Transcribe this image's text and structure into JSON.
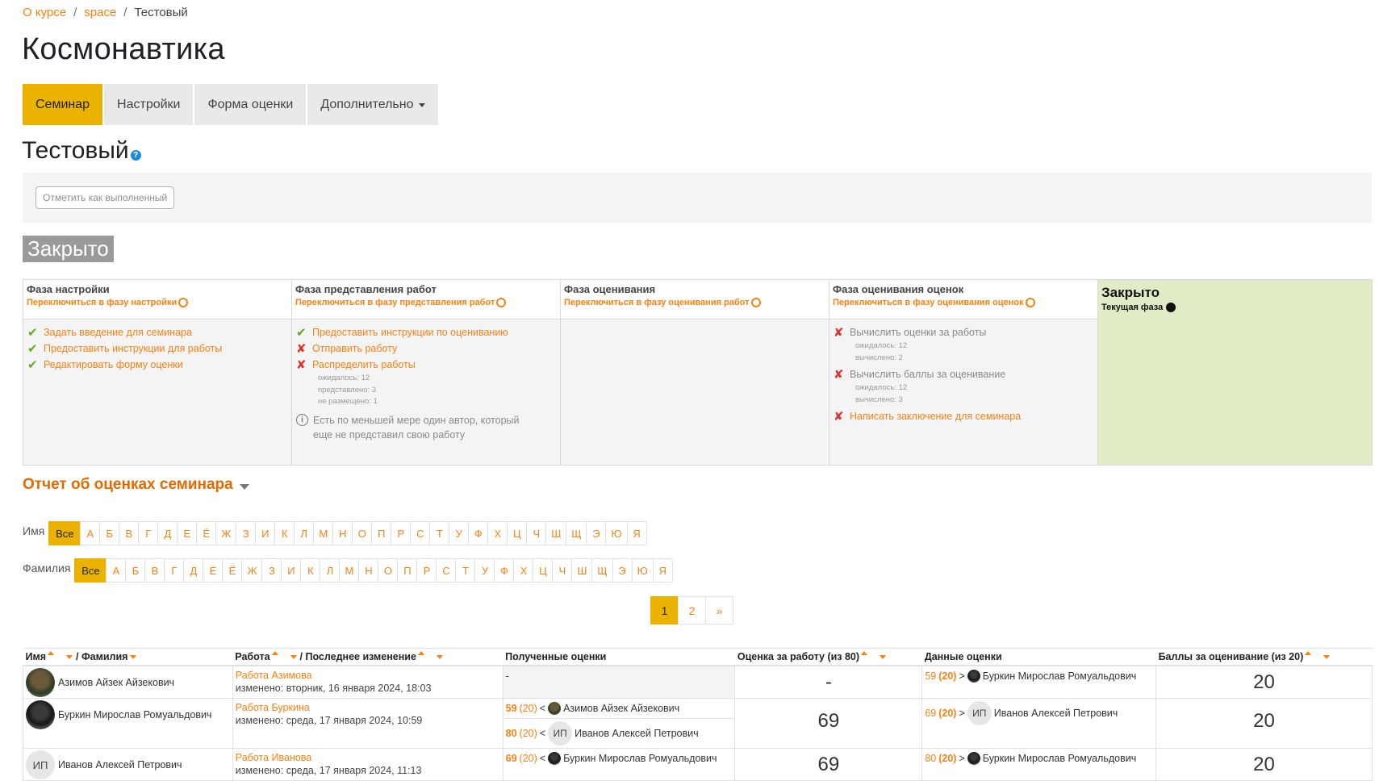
{
  "breadcrumb": {
    "items": [
      "О курсе",
      "space",
      "Тестовый"
    ],
    "separator": "/"
  },
  "title": "Космонавтика",
  "tabs": [
    {
      "label": "Семинар",
      "active": true
    },
    {
      "label": "Настройки",
      "active": false
    },
    {
      "label": "Форма оценки",
      "active": false
    },
    {
      "label": "Дополнительно",
      "active": false,
      "dropdown": true
    }
  ],
  "subtitle": "Тестовый",
  "help_icon": "question-icon",
  "done_button": "Отметить как выполненный",
  "closed_badge": "Закрыто",
  "phases": [
    {
      "name": "Фаза настройки",
      "switch": "Переключиться в фазу настройки",
      "tasks": [
        {
          "status": "done",
          "label": "Задать введение для семинара"
        },
        {
          "status": "done",
          "label": "Предоставить инструкции для работы"
        },
        {
          "status": "done",
          "label": "Редактировать форму оценки"
        }
      ]
    },
    {
      "name": "Фаза представления работ",
      "switch": "Переключиться в фазу представления работ",
      "tasks": [
        {
          "status": "done",
          "label": "Предоставить инструкции по оцениванию"
        },
        {
          "status": "fail",
          "label": "Отправить работу"
        },
        {
          "status": "fail",
          "label": "Распределить работы",
          "details": [
            "ожидалось: 12",
            "представлено: 3",
            "не размещено: 1"
          ]
        }
      ],
      "info": "Есть по меньшей мере один автор, который еще не представил свою работу"
    },
    {
      "name": "Фаза оценивания",
      "switch": "Переключиться в фазу оценивания работ",
      "tasks": []
    },
    {
      "name": "Фаза оценивания оценок",
      "switch": "Переключиться в фазу оценивания оценок",
      "tasks": [
        {
          "status": "fail",
          "grey": true,
          "label": "Вычислить оценки за работы",
          "details": [
            "ожидалось: 12",
            "вычислено: 2"
          ]
        },
        {
          "status": "fail",
          "grey": true,
          "label": "Вычислить баллы за оценивание",
          "details": [
            "ожидалось: 12",
            "вычислено: 3"
          ]
        },
        {
          "status": "fail",
          "grey": false,
          "label": "Написать заключение для семинара"
        }
      ]
    }
  ],
  "current_phase": {
    "name": "Закрыто",
    "label": "Текущая фаза"
  },
  "report": {
    "title": "Отчет об оценках семинара"
  },
  "filters": {
    "first_name_label": "Имя",
    "last_name_label": "Фамилия",
    "all_label": "Все",
    "letters": [
      "А",
      "Б",
      "В",
      "Г",
      "Д",
      "Е",
      "Ё",
      "Ж",
      "З",
      "И",
      "К",
      "Л",
      "М",
      "Н",
      "О",
      "П",
      "Р",
      "С",
      "Т",
      "У",
      "Ф",
      "Х",
      "Ц",
      "Ч",
      "Ш",
      "Щ",
      "Э",
      "Ю",
      "Я"
    ]
  },
  "pagination": {
    "pages": [
      "1",
      "2"
    ],
    "next": "»",
    "current": "1"
  },
  "table": {
    "headers": {
      "first_name": "Имя",
      "last_name": "/ Фамилия",
      "work": "Работа",
      "modified": "/ Последнее изменение",
      "received": "Полученные оценки",
      "work_grade": "Оценка за работу (из 80)",
      "given": "Данные оценки",
      "assess_grade": "Баллы за оценивание (из 20)"
    },
    "rows": [
      {
        "name": "Азимов Айзек Айзекович",
        "avatar": "photo1",
        "work_title": "Работа Азимова",
        "modified": "изменено: вторник, 16 января 2024, 18:03",
        "received": [
          {
            "text": "-"
          }
        ],
        "work_grade": "-",
        "given": [
          {
            "grade": "59",
            "weight": "(20)",
            "arrow": ">",
            "reviewer": "Буркин Мирослав Ромуальдович",
            "avatar": "photo2"
          }
        ],
        "assess_grade": "20"
      },
      {
        "name": "Буркин Мирослав Ромуальдович",
        "avatar": "photo2",
        "work_title": "Работа Буркина",
        "modified": "изменено: среда, 17 января 2024, 10:59",
        "received": [
          {
            "grade": "59",
            "weight": "(20)",
            "arrow": "<",
            "reviewer": "Азимов Айзек Айзекович",
            "avatar": "photo1"
          },
          {
            "grade": "80",
            "weight": "(20)",
            "arrow": "<",
            "reviewer": "Иванов Алексей Петрович",
            "avatar": "initials",
            "initials": "ИП"
          }
        ],
        "work_grade": "69",
        "given": [
          {
            "grade": "69",
            "weight": "(20)",
            "arrow": ">",
            "reviewer": "Иванов Алексей Петрович",
            "avatar": "initials",
            "initials": "ИП"
          }
        ],
        "assess_grade": "20"
      },
      {
        "name": "Иванов Алексей Петрович",
        "avatar": "initials",
        "initials": "ИП",
        "work_title": "Работа Иванова",
        "modified": "изменено: среда, 17 января 2024, 11:13",
        "received": [
          {
            "grade": "69",
            "weight": "(20)",
            "arrow": "<",
            "reviewer": "Буркин Мирослав Ромуальдович",
            "avatar": "photo2"
          }
        ],
        "work_grade": "69",
        "given": [
          {
            "grade": "80",
            "weight": "(20)",
            "arrow": ">",
            "reviewer": "Буркин Мирослав Ромуальдович",
            "avatar": "photo2"
          }
        ],
        "assess_grade": "20"
      }
    ]
  },
  "colors": {
    "accent": "#f98012",
    "active_tab": "#ebb300",
    "current_phase_bg": "#e1ebc5",
    "check": "#5bac22",
    "cross": "#e2312a"
  }
}
